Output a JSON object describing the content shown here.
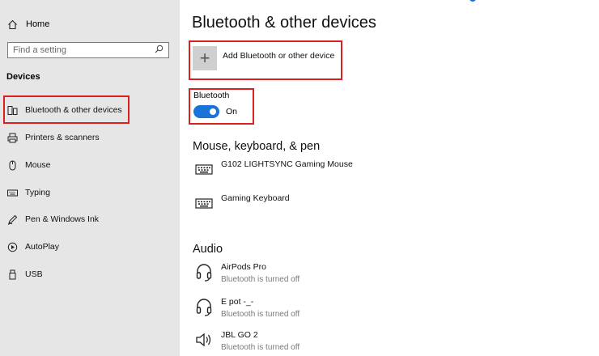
{
  "sidebar": {
    "home_label": "Home",
    "search_placeholder": "Find a setting",
    "section_title": "Devices",
    "items": [
      {
        "label": "Bluetooth & other devices",
        "icon": "bluetooth-devices-icon"
      },
      {
        "label": "Printers & scanners",
        "icon": "printer-icon"
      },
      {
        "label": "Mouse",
        "icon": "mouse-icon"
      },
      {
        "label": "Typing",
        "icon": "keyboard-icon"
      },
      {
        "label": "Pen & Windows Ink",
        "icon": "pen-icon"
      },
      {
        "label": "AutoPlay",
        "icon": "autoplay-icon"
      },
      {
        "label": "USB",
        "icon": "usb-icon"
      }
    ]
  },
  "main": {
    "title": "Bluetooth & other devices",
    "add_device_label": "Add Bluetooth or other device",
    "bluetooth_label": "Bluetooth",
    "bluetooth_state": "On",
    "groups": [
      {
        "title": "Mouse, keyboard, & pen",
        "devices": [
          {
            "name": "G102 LIGHTSYNC Gaming Mouse",
            "icon": "keyboard-icon"
          },
          {
            "name": "Gaming Keyboard",
            "icon": "keyboard-icon"
          }
        ]
      },
      {
        "title": "Audio",
        "devices": [
          {
            "name": "AirPods Pro",
            "status": "Bluetooth is turned off",
            "icon": "headset-icon"
          },
          {
            "name": "E pot -_-",
            "status": "Bluetooth is turned off",
            "icon": "headset-icon"
          },
          {
            "name": "JBL GO 2",
            "status": "Bluetooth is turned off",
            "icon": "speaker-icon"
          }
        ]
      }
    ]
  },
  "colors": {
    "accent": "#1a73d9",
    "highlight_border": "#d9211f",
    "sidebar_bg": "#e6e6e6"
  }
}
